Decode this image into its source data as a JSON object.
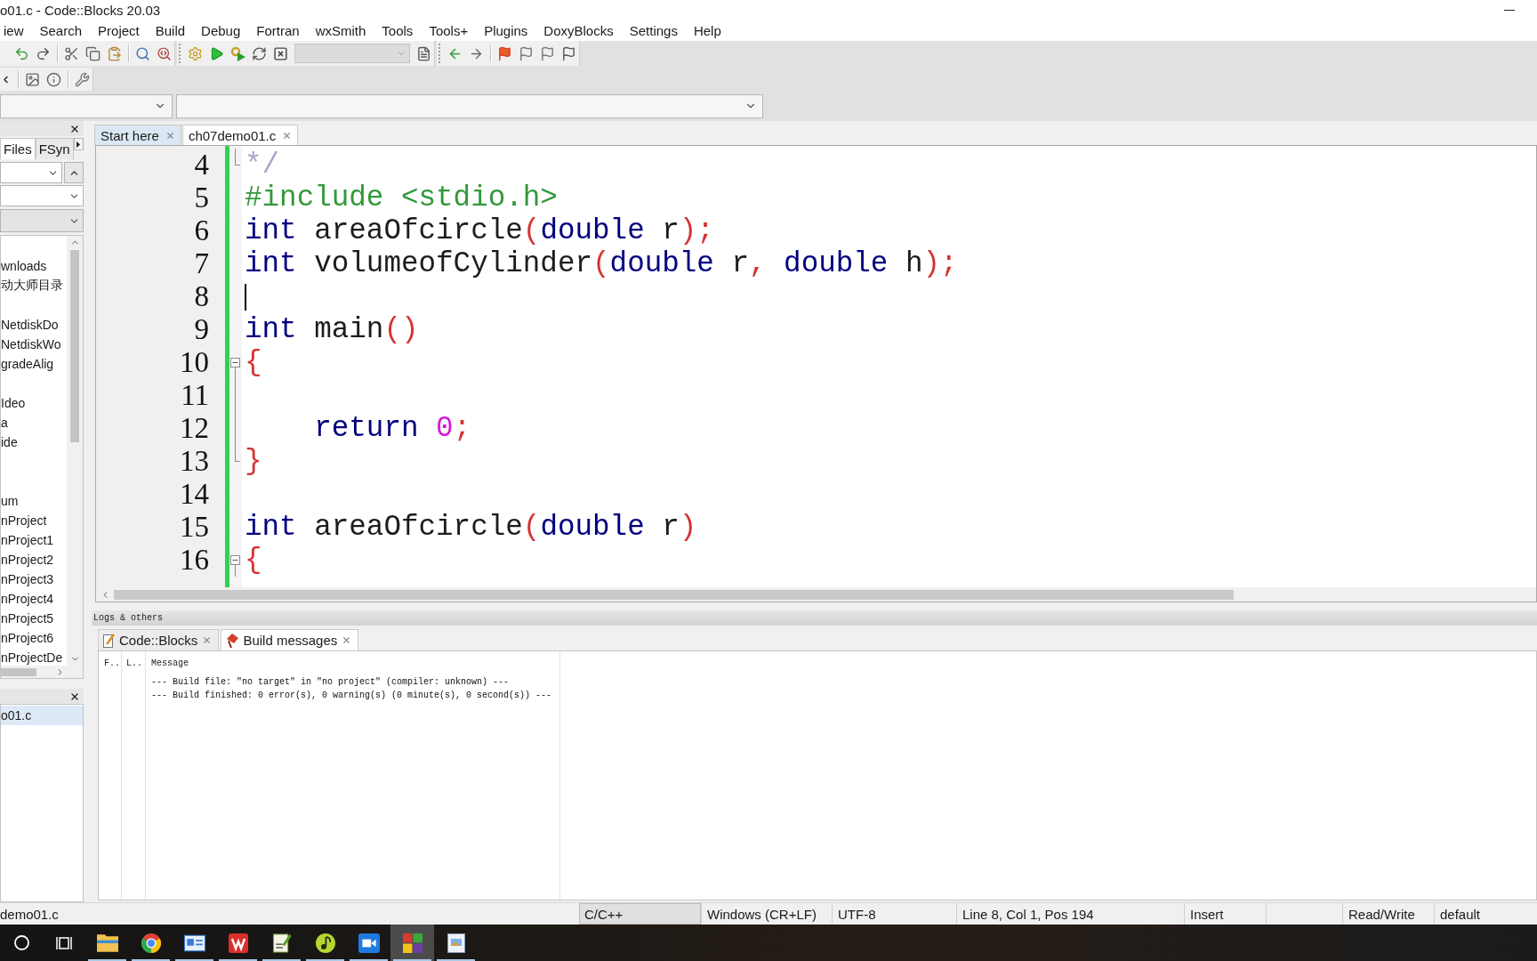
{
  "window": {
    "title": "o01.c - Code::Blocks 20.03"
  },
  "menu_bar": [
    "iew",
    "Search",
    "Project",
    "Build",
    "Debug",
    "Fortran",
    "wxSmith",
    "Tools",
    "Tools+",
    "Plugins",
    "DoxyBlocks",
    "Settings",
    "Help"
  ],
  "toolbar": {
    "target_combo": {
      "disabled": true
    }
  },
  "management_panel": {
    "tabs": [
      {
        "label": "Files",
        "selected": true
      },
      {
        "label": "FSyn",
        "selected": false
      }
    ],
    "tree": [
      {
        "kind": "blank"
      },
      {
        "kind": "entry",
        "label": "wnloads"
      },
      {
        "kind": "entry",
        "label": "动大师目录"
      },
      {
        "kind": "blank"
      },
      {
        "kind": "entry",
        "label": "NetdiskDo"
      },
      {
        "kind": "entry",
        "label": "NetdiskWo"
      },
      {
        "kind": "entry",
        "label": "gradeAlig"
      },
      {
        "kind": "blank"
      },
      {
        "kind": "entry",
        "label": "Ideo"
      },
      {
        "kind": "entry",
        "label": "a"
      },
      {
        "kind": "entry",
        "label": "ide"
      },
      {
        "kind": "blank"
      },
      {
        "kind": "blank"
      },
      {
        "kind": "entry",
        "label": "um"
      },
      {
        "kind": "entry",
        "label": "nProject"
      },
      {
        "kind": "entry",
        "label": "nProject1"
      },
      {
        "kind": "entry",
        "label": "nProject2"
      },
      {
        "kind": "entry",
        "label": "nProject3"
      },
      {
        "kind": "entry",
        "label": "nProject4"
      },
      {
        "kind": "entry",
        "label": "nProject5"
      },
      {
        "kind": "entry",
        "label": "nProject6"
      },
      {
        "kind": "entry",
        "label": "nProjectDe"
      }
    ]
  },
  "open_files_panel": {
    "items": [
      {
        "label": "o01.c",
        "selected": true
      }
    ]
  },
  "editor": {
    "tabs": [
      {
        "label": "Start here",
        "selected": false
      },
      {
        "label": "ch07demo01.c",
        "selected": true
      }
    ],
    "lines": [
      {
        "number": "4",
        "fold": {
          "kind": "end"
        },
        "caret": false,
        "tokens": [
          {
            "kind": "comment",
            "text": "*/"
          }
        ]
      },
      {
        "number": "5",
        "caret": false,
        "tokens": [
          {
            "kind": "preprocessor",
            "text": "#include <stdio.h>"
          }
        ]
      },
      {
        "number": "6",
        "caret": false,
        "tokens": [
          {
            "kind": "keyword",
            "text": "int"
          },
          {
            "kind": "plain",
            "text": " areaOfcircle"
          },
          {
            "kind": "operator",
            "text": "("
          },
          {
            "kind": "keyword",
            "text": "double"
          },
          {
            "kind": "plain",
            "text": " r"
          },
          {
            "kind": "operator",
            "text": ");"
          }
        ]
      },
      {
        "number": "7",
        "caret": false,
        "tokens": [
          {
            "kind": "keyword",
            "text": "int"
          },
          {
            "kind": "plain",
            "text": " volumeofCylinder"
          },
          {
            "kind": "operator",
            "text": "("
          },
          {
            "kind": "keyword",
            "text": "double"
          },
          {
            "kind": "plain",
            "text": " r"
          },
          {
            "kind": "operator",
            "text": ", "
          },
          {
            "kind": "keyword",
            "text": "double"
          },
          {
            "kind": "plain",
            "text": " h"
          },
          {
            "kind": "operator",
            "text": ");"
          }
        ]
      },
      {
        "number": "8",
        "caret": true
      },
      {
        "number": "9",
        "caret": false,
        "tokens": [
          {
            "kind": "keyword",
            "text": "int"
          },
          {
            "kind": "plain",
            "text": " main"
          },
          {
            "kind": "operator",
            "text": "()"
          }
        ]
      },
      {
        "number": "10",
        "fold": {
          "kind": "open"
        },
        "caret": false,
        "tokens": [
          {
            "kind": "operator",
            "text": "{"
          }
        ]
      },
      {
        "number": "11",
        "fold": {
          "kind": "inside"
        },
        "caret": false
      },
      {
        "number": "12",
        "fold": {
          "kind": "inside"
        },
        "caret": false,
        "tokens": [
          {
            "kind": "keyword",
            "text": "    return"
          },
          {
            "kind": "number",
            "text": " 0"
          },
          {
            "kind": "operator",
            "text": ";"
          }
        ]
      },
      {
        "number": "13",
        "fold": {
          "kind": "end"
        },
        "caret": false,
        "tokens": [
          {
            "kind": "operator",
            "text": "}"
          }
        ]
      },
      {
        "number": "14",
        "caret": false
      },
      {
        "number": "15",
        "caret": false,
        "tokens": [
          {
            "kind": "keyword",
            "text": "int"
          },
          {
            "kind": "plain",
            "text": " areaOfcircle"
          },
          {
            "kind": "operator",
            "text": "("
          },
          {
            "kind": "keyword",
            "text": "double"
          },
          {
            "kind": "plain",
            "text": " r"
          },
          {
            "kind": "operator",
            "text": ")"
          }
        ]
      },
      {
        "number": "16",
        "fold": {
          "kind": "open"
        },
        "caret": false,
        "tokens": [
          {
            "kind": "operator",
            "text": "{"
          }
        ]
      }
    ]
  },
  "logs": {
    "title": "Logs & others",
    "tabs": [
      {
        "label": "Code::Blocks",
        "selected": false
      },
      {
        "label": "Build messages",
        "selected": true
      }
    ],
    "columns": [
      "F..",
      "L..",
      "Message"
    ],
    "rows": [
      {
        "message": "--- Build file: \"no target\" in \"no project\" (compiler: unknown) ---"
      },
      {
        "message": "--- Build finished: 0 error(s), 0 warning(s) (0 minute(s), 0 second(s)) ---"
      }
    ]
  },
  "status_bar": [
    {
      "kind": "plain",
      "text": "demo01.c"
    },
    {
      "kind": "boxed",
      "text": "C/C++"
    },
    {
      "kind": "plain",
      "text": "Windows (CR+LF)"
    },
    {
      "kind": "plain",
      "text": "UTF-8"
    },
    {
      "kind": "plain",
      "text": "Line 8, Col 1, Pos 194"
    },
    {
      "kind": "plain",
      "text": "Insert"
    },
    {
      "kind": "plain",
      "text": "Read/Write"
    },
    {
      "kind": "plain",
      "text": "default"
    }
  ],
  "taskbar": {
    "apps": [
      {
        "running": true,
        "selected": false
      },
      {
        "running": true,
        "selected": false
      },
      {
        "running": true,
        "selected": false
      },
      {
        "running": true,
        "selected": false
      },
      {
        "running": true,
        "selected": false
      },
      {
        "running": true,
        "selected": false
      },
      {
        "running": true,
        "selected": false
      },
      {
        "running": true,
        "selected": true
      },
      {
        "running": true,
        "selected": false
      }
    ]
  }
}
